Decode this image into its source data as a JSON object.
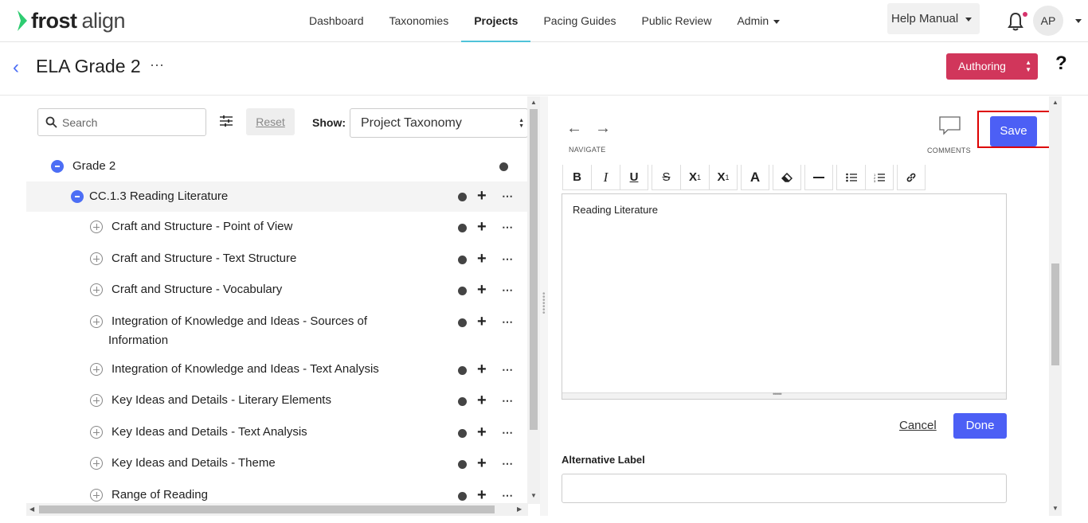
{
  "brand": {
    "name": "frost",
    "suffix": "align",
    "accent": "#2ecc71"
  },
  "nav": {
    "items": [
      {
        "label": "Dashboard"
      },
      {
        "label": "Taxonomies"
      },
      {
        "label": "Projects"
      },
      {
        "label": "Pacing Guides"
      },
      {
        "label": "Public Review"
      },
      {
        "label": "Admin"
      }
    ],
    "active": "Projects",
    "help_label": "Help Manual",
    "user_initials": "AP"
  },
  "project": {
    "title": "ELA Grade 2",
    "status_label": "Authoring",
    "status_color": "#d1365b",
    "help_icon": "?"
  },
  "tree": {
    "search_placeholder": "Search",
    "reset_label": "Reset",
    "show_label": "Show:",
    "show_value": "Project Taxonomy",
    "root": {
      "label": "Grade 2"
    },
    "selected": {
      "label": "CC.1.3 Reading Literature"
    },
    "children": [
      {
        "label": "Craft and Structure - Point of View"
      },
      {
        "label": "Craft and Structure - Text Structure"
      },
      {
        "label": "Craft and Structure - Vocabulary"
      },
      {
        "label": "Integration of Knowledge and Ideas - Sources of",
        "label2": "Information"
      },
      {
        "label": "Integration of Knowledge and Ideas - Text Analysis"
      },
      {
        "label": "Key Ideas and Details - Literary Elements"
      },
      {
        "label": "Key Ideas and Details - Text Analysis"
      },
      {
        "label": "Key Ideas and Details - Theme"
      },
      {
        "label": "Range of Reading"
      }
    ]
  },
  "editor": {
    "navigate_label": "NAVIGATE",
    "comments_label": "COMMENTS",
    "save_label": "Save",
    "content": "Reading Literature",
    "cancel_label": "Cancel",
    "done_label": "Done",
    "alt_label_title": "Alternative Label",
    "alt_label_value": "",
    "toolbar": [
      "bold-icon",
      "italic-icon",
      "underline-icon",
      "strikethrough-icon",
      "superscript-icon",
      "subscript-icon",
      "font-color-icon",
      "clear-format-icon",
      "horizontal-rule-icon",
      "bullet-list-icon",
      "numbered-list-icon",
      "link-icon"
    ]
  }
}
